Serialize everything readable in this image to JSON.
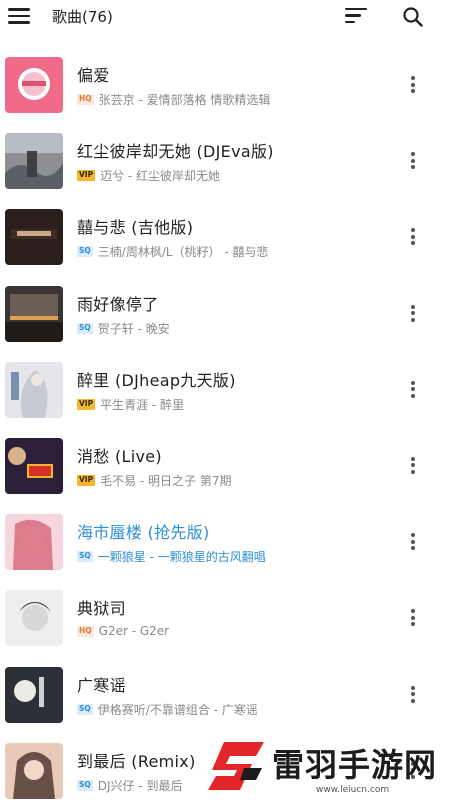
{
  "header": {
    "title": "歌曲(76)",
    "icons": [
      "menu-icon",
      "sort-icon",
      "search-icon"
    ]
  },
  "songs": [
    {
      "title": "偏爱",
      "quality": "HQ",
      "meta": "张芸京 - 爱情部落格 情歌精选辑",
      "active": false
    },
    {
      "title": "红尘彼岸却无她 (DJEva版)",
      "quality": "VIP",
      "meta": "迈兮 - 红尘彼岸却无她",
      "active": false
    },
    {
      "title": "囍与悲 (吉他版)",
      "quality": "SQ",
      "meta": "三楠/周林枫/L（桃籽） - 囍与悲",
      "active": false
    },
    {
      "title": "雨好像停了",
      "quality": "SQ",
      "meta": "贺子轩 - 晚安",
      "active": false
    },
    {
      "title": "醉里 (DJheap九天版)",
      "quality": "VIP",
      "meta": "平生青涯 - 醉里",
      "active": false
    },
    {
      "title": "消愁 (Live)",
      "quality": "VIP",
      "meta": "毛不易 - 明日之子 第7期",
      "active": false
    },
    {
      "title": "海市蜃楼 (抢先版)",
      "quality": "SQ",
      "meta": "一颗狼星 - 一颗狼星的古风翻唱",
      "active": true
    },
    {
      "title": "典狱司",
      "quality": "HQ",
      "meta": "G2er - G2er",
      "active": false
    },
    {
      "title": "广寒谣",
      "quality": "SQ",
      "meta": "伊格赛听/不靠谱组合 - 广寒谣",
      "active": false
    },
    {
      "title": "到最后 (Remix)",
      "quality": "SQ",
      "meta": "DJ兴仔 - 到最后",
      "active": false
    }
  ],
  "badges": {
    "HQ": "HQ",
    "SQ": "SQ",
    "VIP": "VIP"
  },
  "watermark": {
    "text": "雷羽手游网",
    "url": "www.leiucn.com"
  },
  "colors": {
    "accent": "#2f8fd6",
    "hq": "#e07a3c",
    "vip": "#f3b630",
    "watermark_red": "#e3262b"
  }
}
